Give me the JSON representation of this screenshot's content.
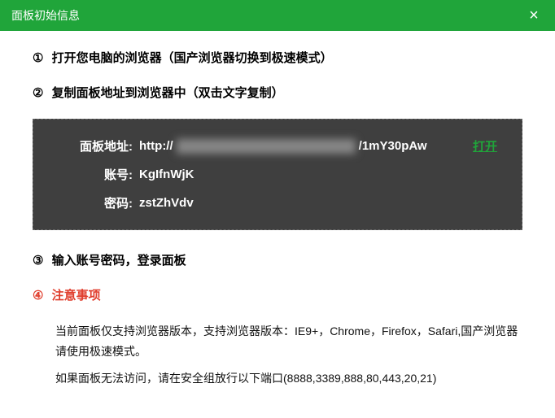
{
  "titlebar": {
    "title": "面板初始信息"
  },
  "steps": {
    "s1": {
      "num": "①",
      "text": "打开您电脑的浏览器（国产浏览器切换到极速模式）"
    },
    "s2": {
      "num": "②",
      "text": "复制面板地址到浏览器中（双击文字复制）"
    },
    "s3": {
      "num": "③",
      "text": "输入账号密码，登录面板"
    },
    "s4": {
      "num": "④",
      "text": "注意事项"
    }
  },
  "info": {
    "addr_label": "面板地址:",
    "url_prefix": "http://",
    "url_suffix": "/1mY30pAw",
    "open_label": "打开",
    "user_label": "账号:",
    "user_value": "KgIfnWjK",
    "pass_label": "密码:",
    "pass_value": "zstZhVdv"
  },
  "notice": {
    "line1": "当前面板仅支持浏览器版本，支持浏览器版本：IE9+，Chrome，Firefox，Safari,国产浏览器请使用极速模式。",
    "line2": "如果面板无法访问，请在安全组放行以下端口(8888,3389,888,80,443,20,21)"
  }
}
